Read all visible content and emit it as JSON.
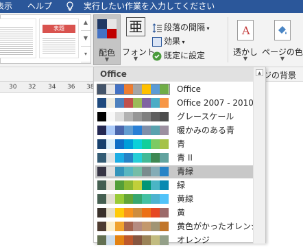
{
  "menubar": {
    "items": [
      {
        "label": "表示"
      },
      {
        "label": "ヘルプ"
      },
      {
        "label": "実行したい作業を入力してください"
      }
    ]
  },
  "ribbon": {
    "gallery": {
      "thumb_title": "表題"
    },
    "colors_label": "配色",
    "fonts_label": "フォント",
    "fonts_glyph": "亜",
    "paragraph_spacing_label": "段落の間隔",
    "effects_label": "効果",
    "set_default_label": "既定に設定",
    "watermark_label": "透かし",
    "page_color_label": "ページの色",
    "page_background_group": "ジの背景"
  },
  "ruler": {
    "ticks": [
      "30",
      "32",
      "34",
      "36",
      "38"
    ]
  },
  "dropdown": {
    "header": "Office",
    "selected_index": 0,
    "hover_index": 6,
    "themes": [
      {
        "name": "Office",
        "colors": [
          "#44546a",
          "#e7e6e6",
          "#4472c4",
          "#ed7d31",
          "#a5a5a5",
          "#ffc000",
          "#5b9bd5",
          "#70ad47"
        ]
      },
      {
        "name": "Office 2007 - 2010",
        "colors": [
          "#1f497d",
          "#eeece1",
          "#4f81bd",
          "#c0504d",
          "#9bbb59",
          "#8064a2",
          "#4bacc6",
          "#f79646"
        ]
      },
      {
        "name": "グレースケール",
        "colors": [
          "#000000",
          "#f8f8f8",
          "#dddddd",
          "#b2b2b2",
          "#969696",
          "#808080",
          "#5f5f5f",
          "#4d4d4d"
        ]
      },
      {
        "name": "暖かみのある青",
        "colors": [
          "#242852",
          "#accbf9",
          "#4a66ac",
          "#629dd1",
          "#297fd5",
          "#7f8fa9",
          "#5aa2ae",
          "#9d90a0"
        ]
      },
      {
        "name": "青",
        "colors": [
          "#17406d",
          "#dbeff9",
          "#0f6fc6",
          "#009dd9",
          "#0bd0d9",
          "#10cf9b",
          "#7cca62",
          "#a5c249"
        ]
      },
      {
        "name": "青 II",
        "colors": [
          "#335b74",
          "#dfe3e5",
          "#1cade4",
          "#2683c6",
          "#27ced7",
          "#42ba97",
          "#3e8853",
          "#62a39f"
        ]
      },
      {
        "name": "青緑",
        "colors": [
          "#373545",
          "#dedede",
          "#3494ba",
          "#58b6c0",
          "#75bda7",
          "#7a8c8e",
          "#84acb6",
          "#2683c6"
        ]
      },
      {
        "name": "緑",
        "colors": [
          "#455f51",
          "#e3ded1",
          "#549e39",
          "#8ab833",
          "#c0cf3a",
          "#029676",
          "#4ab5c4",
          "#0989b1"
        ]
      },
      {
        "name": "黄緑",
        "colors": [
          "#455f51",
          "#e3ded1",
          "#99cb38",
          "#63a537",
          "#37a76f",
          "#44c1a3",
          "#4eb3cf",
          "#51c3f9"
        ]
      },
      {
        "name": "黄",
        "colors": [
          "#39302a",
          "#e5dec9",
          "#ffca08",
          "#f8931d",
          "#ce8d3e",
          "#ec7016",
          "#e64823",
          "#9c6a6a"
        ]
      },
      {
        "name": "黄色がかったオレンジ",
        "colors": [
          "#4e3b30",
          "#fbeec9",
          "#f0a22e",
          "#a5644e",
          "#b58b80",
          "#c3986d",
          "#a19574",
          "#c17529"
        ]
      },
      {
        "name": "オレンジ",
        "colors": [
          "#637052",
          "#ccddea",
          "#e48312",
          "#bd582c",
          "#865640",
          "#9b8357",
          "#c2bc80",
          "#94a088"
        ]
      }
    ]
  }
}
